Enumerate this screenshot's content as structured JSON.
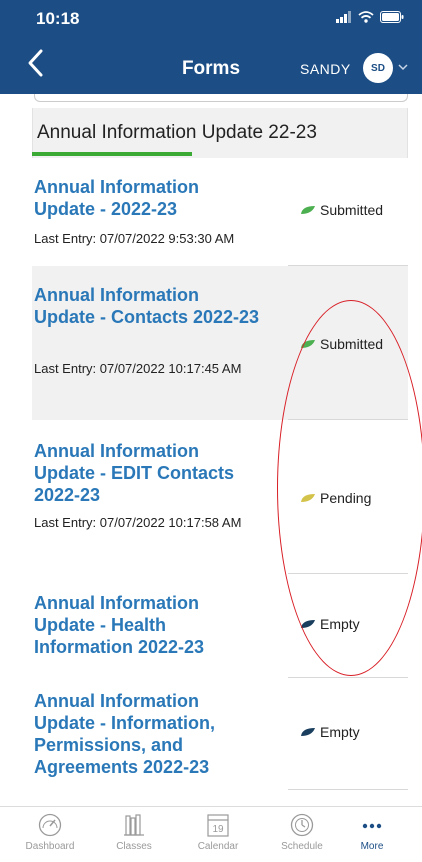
{
  "status_bar": {
    "time": "10:18"
  },
  "nav": {
    "title": "Forms",
    "user_name": "SANDY",
    "avatar_initials": "SD"
  },
  "section": {
    "title": "Annual Information Update 22-23"
  },
  "colors": {
    "header_bg": "#1c4e85",
    "link": "#2a78b8",
    "progress": "#3aaa35",
    "status_submitted": "#4caf50",
    "status_pending": "#d4c34a",
    "status_empty": "#1a3e5e",
    "annotation": "#d81f26"
  },
  "forms": [
    {
      "title": "Annual Information Update - 2022-23",
      "last_entry": "Last Entry: 07/07/2022 9:53:30 AM",
      "status": "Submitted",
      "status_icon": "leaf-green-icon"
    },
    {
      "title": "Annual Information Update - Contacts 2022-23",
      "last_entry": "Last Entry: 07/07/2022 10:17:45 AM",
      "status": "Submitted",
      "status_icon": "leaf-green-icon"
    },
    {
      "title": "Annual Information Update - EDIT Contacts 2022-23",
      "last_entry": "Last Entry: 07/07/2022 10:17:58 AM",
      "status": "Pending",
      "status_icon": "leaf-yellow-icon"
    },
    {
      "title": "Annual Information Update - Health Information 2022-23",
      "last_entry": "",
      "status": "Empty",
      "status_icon": "leaf-navy-icon"
    },
    {
      "title": "Annual Information Update - Information, Permissions, and Agreements 2022-23",
      "last_entry": "",
      "status": "Empty",
      "status_icon": "leaf-navy-icon"
    }
  ],
  "tabs": [
    {
      "label": "Dashboard",
      "icon": "gauge-icon"
    },
    {
      "label": "Classes",
      "icon": "books-icon"
    },
    {
      "label": "Calendar",
      "icon": "calendar-icon",
      "day": "19"
    },
    {
      "label": "Schedule",
      "icon": "clock-icon"
    },
    {
      "label": "More",
      "icon": "more-dots-icon",
      "active": true
    }
  ]
}
